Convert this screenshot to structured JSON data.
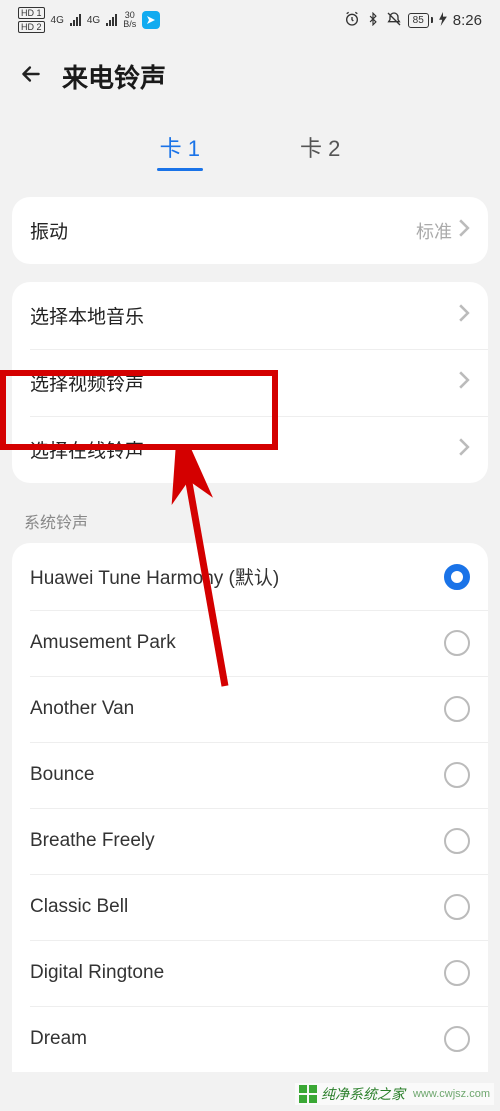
{
  "status": {
    "hd1": "HD 1",
    "hd2": "HD 2",
    "sig1": "4G",
    "sig2": "4G",
    "net_speed_top": "30",
    "net_speed_bot": "B/s",
    "battery": "85",
    "time": "8:26"
  },
  "header": {
    "title": "来电铃声"
  },
  "tabs": {
    "t1": "卡 1",
    "t2": "卡 2"
  },
  "vibration": {
    "label": "振动",
    "value": "标准"
  },
  "sources": {
    "local": "选择本地音乐",
    "video": "选择视频铃声",
    "online": "选择在线铃声"
  },
  "section_label": "系统铃声",
  "ringtones": [
    {
      "name": "Huawei Tune Harmony (默认)",
      "selected": true
    },
    {
      "name": "Amusement Park",
      "selected": false
    },
    {
      "name": "Another Van",
      "selected": false
    },
    {
      "name": "Bounce",
      "selected": false
    },
    {
      "name": "Breathe Freely",
      "selected": false
    },
    {
      "name": "Classic Bell",
      "selected": false
    },
    {
      "name": "Digital Ringtone",
      "selected": false
    },
    {
      "name": "Dream",
      "selected": false
    }
  ],
  "watermark": {
    "text": "纯净系统之家",
    "url": "www.cwjsz.com"
  },
  "colors": {
    "accent": "#1a73e8",
    "annotation": "#d40000"
  }
}
